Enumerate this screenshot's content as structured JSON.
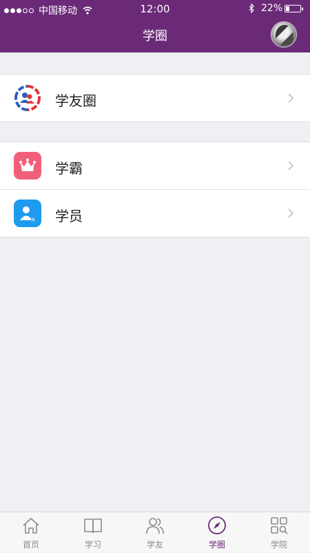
{
  "status_bar": {
    "carrier": "中国移动",
    "time": "12:00",
    "battery": "22%",
    "battery_level": 0.22
  },
  "nav": {
    "title": "学圈"
  },
  "groups": [
    {
      "items": [
        {
          "label": "学友圈",
          "icon": "friends-circle-icon"
        }
      ]
    },
    {
      "items": [
        {
          "label": "学霸",
          "icon": "crown-icon",
          "color": "#f0607a"
        },
        {
          "label": "学员",
          "icon": "student-icon",
          "color": "#1e9bef"
        }
      ]
    }
  ],
  "tabbar": {
    "tabs": [
      {
        "label": "首页",
        "icon": "home-icon"
      },
      {
        "label": "学习",
        "icon": "book-icon"
      },
      {
        "label": "学友",
        "icon": "people-icon"
      },
      {
        "label": "学圈",
        "icon": "compass-icon",
        "active": true
      },
      {
        "label": "学院",
        "icon": "grid-search-icon"
      }
    ]
  },
  "colors": {
    "accent": "#6b2a78",
    "background": "#efeff4",
    "tab_inactive": "#8a8a8a"
  }
}
